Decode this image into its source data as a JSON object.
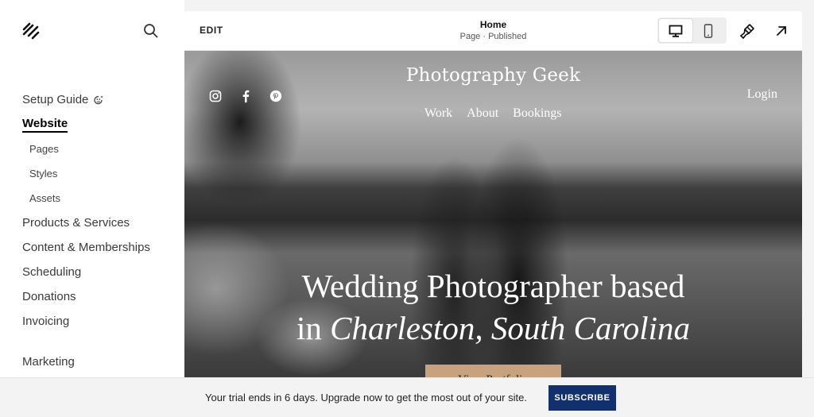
{
  "sidebar": {
    "logo": "squarespace-logo",
    "search_icon": "search-icon",
    "items": [
      {
        "label": "Setup Guide",
        "level": 0,
        "active": false,
        "icon": "sparkle-icon"
      },
      {
        "label": "Website",
        "level": 0,
        "active": true
      },
      {
        "label": "Pages",
        "level": 1,
        "active": false
      },
      {
        "label": "Styles",
        "level": 1,
        "active": false
      },
      {
        "label": "Assets",
        "level": 1,
        "active": false
      },
      {
        "label": "Products & Services",
        "level": 0,
        "active": false
      },
      {
        "label": "Content & Memberships",
        "level": 0,
        "active": false
      },
      {
        "label": "Scheduling",
        "level": 0,
        "active": false
      },
      {
        "label": "Donations",
        "level": 0,
        "active": false
      },
      {
        "label": "Invoicing",
        "level": 0,
        "active": false
      },
      {
        "label": "Marketing",
        "level": 0,
        "active": false
      }
    ]
  },
  "editor": {
    "edit_label": "EDIT",
    "page_title": "Home",
    "page_status": "Page · Published",
    "device_buttons": [
      {
        "name": "desktop-icon",
        "active": true
      },
      {
        "name": "mobile-icon",
        "active": false
      }
    ],
    "tools": [
      "site-styles-brush-icon",
      "open-external-arrow-icon"
    ]
  },
  "site": {
    "title": "Photography Geek",
    "nav": [
      "Work",
      "About",
      "Bookings"
    ],
    "login": "Login",
    "social": [
      "instagram-icon",
      "facebook-icon",
      "pinterest-icon"
    ],
    "headline_line1": "Wedding Photographer based",
    "headline_line2_prefix": "in ",
    "headline_line2_italic": "Charleston, South Carolina",
    "cta_label": "View Portfolio"
  },
  "trial_bar": {
    "message": "Your trial ends in 6 days. Upgrade now to get the most out of your site.",
    "subscribe_label": "SUBSCRIBE",
    "subscribe_color": "#12306e"
  },
  "colors": {
    "accent_cta": "#c6a27f",
    "background": "#f3f3f3"
  }
}
